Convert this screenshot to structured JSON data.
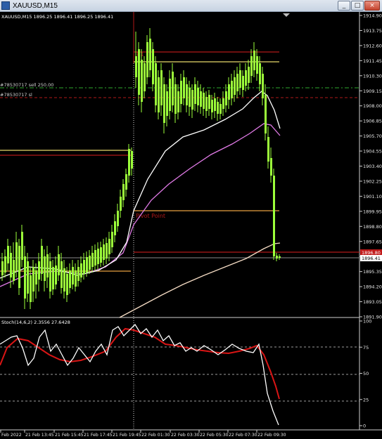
{
  "window": {
    "title": "XAUUSD,M15",
    "minimize_label": "_",
    "maximize_label": "□",
    "close_label": "×"
  },
  "chart_info": "XAUUSD,M15  1896.25 1896.41 1896.25 1896.41",
  "indicator_info": "Stoch(14,6,2) 2.3556 27.6428",
  "levels": {
    "sell_label": "#78530717 sell 250.00",
    "sl_label": "#78530717 sl",
    "pivot_label": "Pivot Point",
    "r1_label": "R1",
    "current_price": "1896.41",
    "red_tag_price": "1896.80"
  },
  "price_axis": [
    "1914.90",
    "1913.75",
    "1912.60",
    "1911.45",
    "1910.30",
    "1909.15",
    "1908.00",
    "1906.85",
    "1905.70",
    "1904.55",
    "1903.40",
    "1902.25",
    "1901.10",
    "1899.95",
    "1898.80",
    "1897.65",
    "1896.50",
    "1895.35",
    "1894.20",
    "1893.05",
    "1891.90"
  ],
  "stoch_axis": [
    "100",
    "75",
    "50",
    "25",
    "0"
  ],
  "time_axis": [
    "Feb 2022",
    "21 Feb 13:45",
    "21 Feb 15:45",
    "21 Feb 17:45",
    "21 Feb 19:45",
    "22 Feb 01:30",
    "22 Feb 03:30",
    "22 Feb 05:30",
    "22 Feb 07:30",
    "22 Feb 09:30"
  ],
  "chart_data": {
    "type": "line",
    "title": "XAUUSD,M15",
    "x_range": [
      "21 Feb 11:45",
      "22 Feb 09:45"
    ],
    "ylim": [
      1891.9,
      1914.9
    ],
    "grid": false,
    "series": [],
    "levels": {
      "sell": 1909.15,
      "sl": 1908.6,
      "yellow_top": 1911.45,
      "red_top": 1912.1,
      "left_red": 1904.3,
      "left_yellow": 1904.6,
      "pivot": 1899.95,
      "red_bottom": 1896.8,
      "left_orange": 1895.1,
      "current": 1896.41
    },
    "stochastic": {
      "name": "Stoch(14,6,2)",
      "ylim": [
        0,
        100
      ],
      "main_last": 2.3556,
      "signal_last": 27.6428
    }
  },
  "colors": {
    "candle": "#9cff3a",
    "ma_white": "#ffffff",
    "ma_violet": "#e07ae6",
    "ma_beige": "#f5dcc4",
    "level_red": "#b01818",
    "level_yellow": "#e8d96a",
    "sell_line": "#2ea82e",
    "signal": "#d91515"
  }
}
